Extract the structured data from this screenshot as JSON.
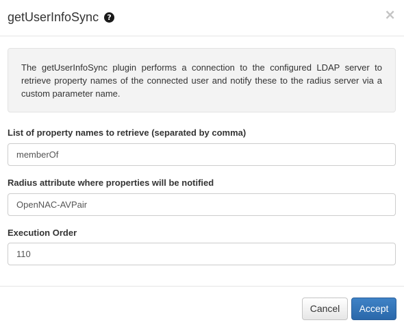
{
  "header": {
    "title": "getUserInfoSync",
    "help_icon": "question-circle-icon",
    "close_glyph": "×"
  },
  "info": {
    "text": "The getUserInfoSync plugin performs a connection to the configured LDAP server to retrieve property names of the connected user and notify these to the radius server via a custom parameter name."
  },
  "fields": [
    {
      "label": "List of property names to retrieve (separated by comma)",
      "value": "memberOf"
    },
    {
      "label": "Radius attribute where properties will be notified",
      "value": "OpenNAC-AVPair"
    },
    {
      "label": "Execution Order",
      "value": "110"
    }
  ],
  "footer": {
    "cancel_label": "Cancel",
    "accept_label": "Accept"
  },
  "colors": {
    "accent": "#337ab7",
    "info_bg": "#f3f3f3"
  }
}
